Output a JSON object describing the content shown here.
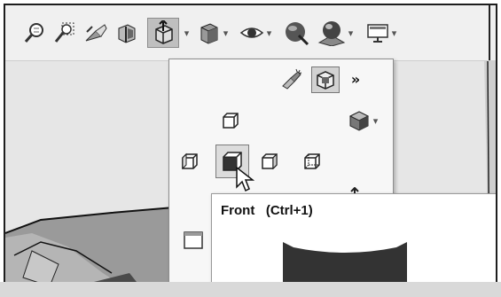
{
  "toolbar": {
    "icons": [
      "zoom-to-fit-icon",
      "zoom-to-area-icon",
      "previous-view-icon",
      "section-view-icon",
      "view-orientation-icon",
      "display-style-icon",
      "hide-show-items-icon",
      "edit-appearance-icon",
      "apply-scene-icon",
      "view-settings-icon"
    ]
  },
  "dropdown": {
    "more_glyph": "»",
    "views": [
      "top-view-icon",
      "left-view-icon",
      "front-view-icon",
      "right-view-icon",
      "back-view-icon",
      "isometric-view-icon",
      "single-view-icon"
    ]
  },
  "tooltip": {
    "title": "Front   (Ctrl+1)"
  },
  "colors": {
    "selected_face": "#333333",
    "toolbar_bg": "#f0f0f0",
    "menu_bg": "#f7f7f7"
  }
}
